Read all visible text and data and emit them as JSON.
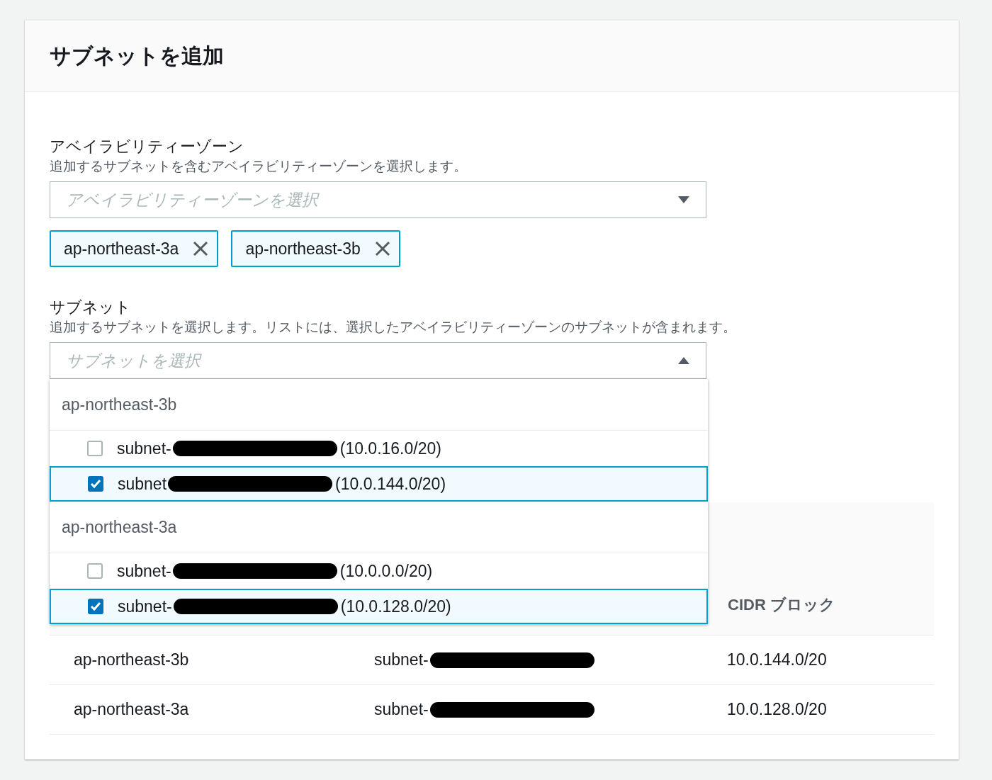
{
  "title": "サブネットを追加",
  "az": {
    "label": "アベイラビリティーゾーン",
    "description": "追加するサブネットを含むアベイラビリティーゾーンを選択します。",
    "placeholder": "アベイラビリティーゾーンを選択",
    "expanded": false
  },
  "az_tokens": [
    {
      "label": "ap-northeast-3a"
    },
    {
      "label": "ap-northeast-3b"
    }
  ],
  "subnet": {
    "label": "サブネット",
    "description": "追加するサブネットを選択します。リストには、選択したアベイラビリティーゾーンのサブネットが含まれます。",
    "placeholder": "サブネットを選択",
    "expanded": true
  },
  "dropdown_groups": [
    {
      "label": "ap-northeast-3b",
      "options": [
        {
          "prefix": "subnet-",
          "cidr": "(10.0.16.0/20)",
          "checked": false,
          "redacted": true
        },
        {
          "prefix": "subnet",
          "cidr": "(10.0.144.0/20)",
          "checked": true,
          "redacted": true
        }
      ]
    },
    {
      "label": "ap-northeast-3a",
      "options": [
        {
          "prefix": "subnet-",
          "cidr": "(10.0.0.0/20)",
          "checked": false,
          "redacted": true
        },
        {
          "prefix": "subnet-",
          "cidr": "(10.0.128.0/20)",
          "checked": true,
          "redacted": true
        }
      ]
    }
  ],
  "table": {
    "column_3_header": "CIDR ブロック",
    "rows": [
      {
        "zone": "ap-northeast-3b",
        "subnet": "subnet-",
        "redacted": true,
        "cidr": "10.0.144.0/20"
      },
      {
        "zone": "ap-northeast-3a",
        "subnet": "subnet-",
        "redacted": true,
        "cidr": "10.0.128.0/20"
      }
    ]
  }
}
